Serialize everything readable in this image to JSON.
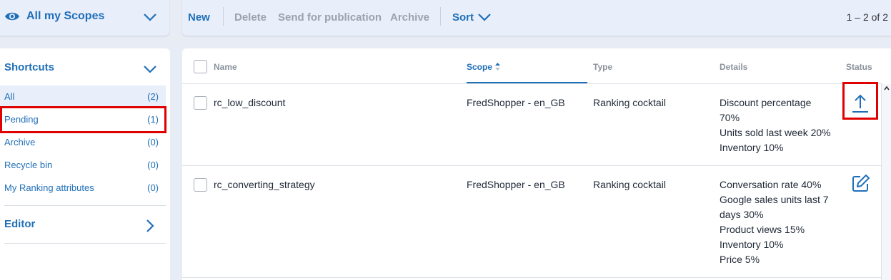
{
  "scope_selector": {
    "label": "All my Scopes"
  },
  "toolbar": {
    "new_label": "New",
    "delete_label": "Delete",
    "send_label": "Send for publication",
    "archive_label": "Archive",
    "sort_label": "Sort",
    "pager": "1 – 2 of 2"
  },
  "sidebar": {
    "shortcuts_title": "Shortcuts",
    "items": [
      {
        "label": "All",
        "count": "(2)"
      },
      {
        "label": "Pending",
        "count": "(1)"
      },
      {
        "label": "Archive",
        "count": "(0)"
      },
      {
        "label": "Recycle bin",
        "count": "(0)"
      },
      {
        "label": "My Ranking attributes",
        "count": "(0)"
      }
    ],
    "editor_title": "Editor"
  },
  "table": {
    "headers": {
      "name": "Name",
      "scope": "Scope",
      "type": "Type",
      "details": "Details",
      "status": "Status"
    },
    "rows": [
      {
        "name": "rc_low_discount",
        "scope": "FredShopper - en_GB",
        "type": "Ranking cocktail",
        "details": [
          "Discount percentage",
          "70%",
          "Units sold last week 20%",
          "Inventory 10%"
        ],
        "status_icon": "upload-arrow-icon"
      },
      {
        "name": "rc_converting_strategy",
        "scope": "FredShopper - en_GB",
        "type": "Ranking cocktail",
        "details": [
          "Conversation rate 40%",
          "Google sales units last 7",
          "days 30%",
          "Product views 15%",
          "Inventory 10%",
          "Price 5%"
        ],
        "status_icon": "edit-icon"
      }
    ]
  },
  "colors": {
    "accent": "#1f6fb8",
    "highlight": "#e00000",
    "panel": "#e8eefa"
  }
}
